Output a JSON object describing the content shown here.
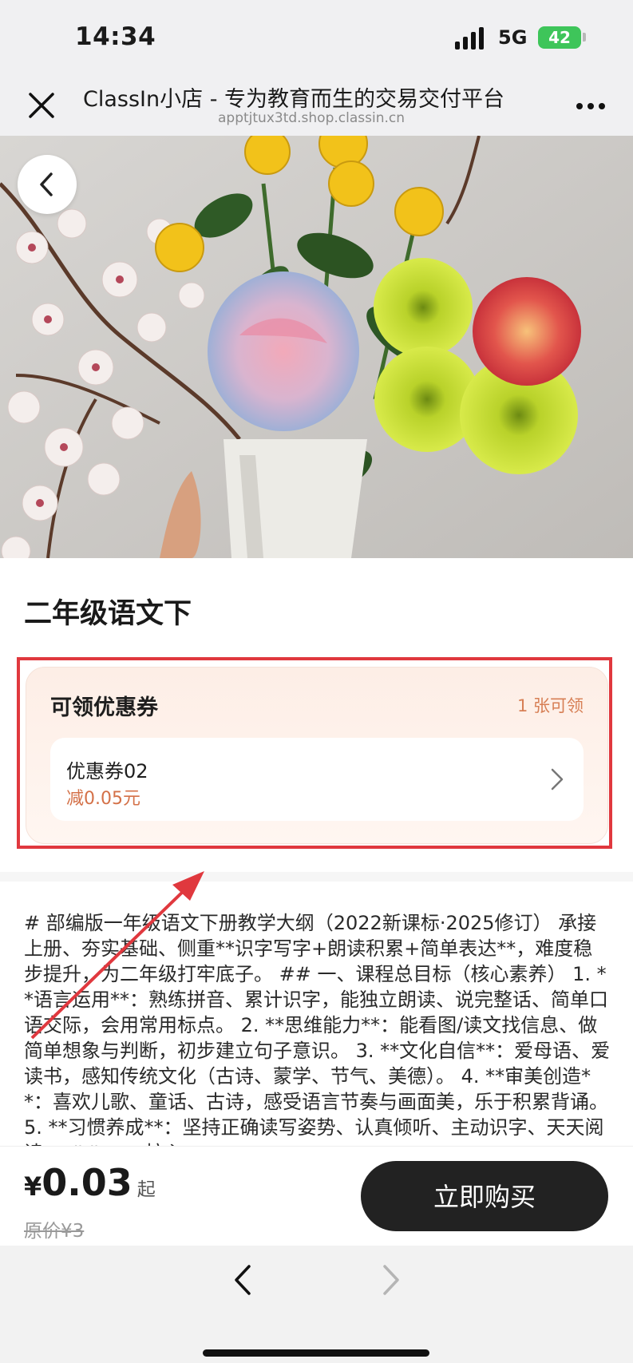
{
  "status_bar": {
    "time": "14:34",
    "network": "5G",
    "battery": "42"
  },
  "browser": {
    "title": "ClassIn小店 - 专为教育而生的交易交付平台",
    "url": "apptjtux3td.shop.classin.cn"
  },
  "product": {
    "title": "二年级语文下"
  },
  "coupons": {
    "heading": "可领优惠券",
    "count": "1 张可领",
    "items": [
      {
        "name": "优惠券02",
        "value": "减0.05元"
      }
    ]
  },
  "description": "# 部编版一年级语文下册教学大纲（2022新课标·2025修订） 承接上册、夯实基础、侧重**识字写字+朗读积累+简单表达**，难度稳步提升，为二年级打牢底子。 ## 一、课程总目标（核心素养） 1. **语言运用**：熟练拼音、累计识字，能独立朗读、说完整话、简单口语交际，会用常用标点。 2. **思维能力**：能看图/读文找信息、做简单想象与判断，初步建立句子意识。 3. **文化自信**：爱母语、爱读书，感知传统文化（古诗、蒙学、节气、美德）。 4. **审美创造**：喜欢儿歌、童话、古诗，感受语言节奏与画面美，乐于积累背诵。 5. **习惯养成**：坚持正确读写姿势、认真倾听、主动识字、天天阅读。 ## 二、核心",
  "purchase": {
    "currency": "¥",
    "price": "0.03",
    "price_suffix": "起",
    "original_price": "原价¥3",
    "buy_label": "立即购买"
  },
  "icons": {
    "close": "close-icon",
    "more": "more-icon",
    "back": "chevron-left-icon",
    "coupon_arrow": "chevron-right-icon",
    "nav_back": "chevron-left-icon",
    "nav_forward": "chevron-right-icon"
  },
  "colors": {
    "accent_coupon": "#d47148",
    "annotation": "#e0383e",
    "buy_button": "#222222"
  }
}
